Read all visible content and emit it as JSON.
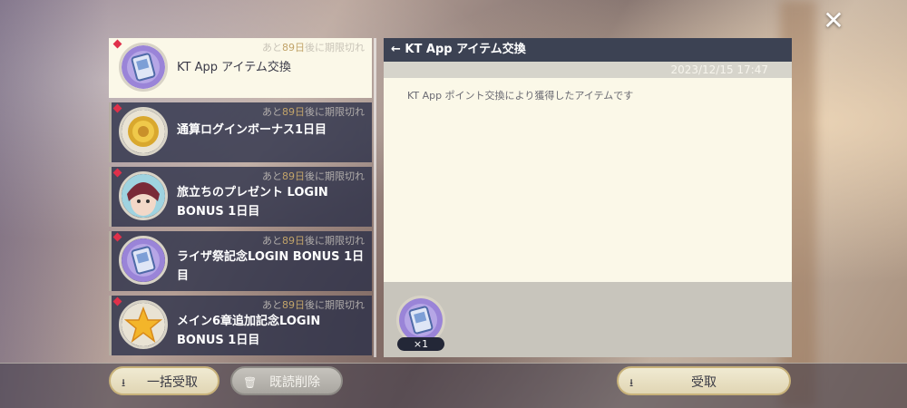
{
  "close_label": "✕",
  "list": {
    "items": [
      {
        "expire_prefix": "あと",
        "expire_days": "89日",
        "expire_suffix": "後に期限切れ",
        "title": "KT App アイテム交換",
        "selected": true
      },
      {
        "expire_prefix": "あと",
        "expire_days": "89日",
        "expire_suffix": "後に期限切れ",
        "title": "通算ログインボーナス1日目",
        "selected": false
      },
      {
        "expire_prefix": "あと",
        "expire_days": "89日",
        "expire_suffix": "後に期限切れ",
        "title": "旅立ちのプレゼント LOGIN BONUS 1日目",
        "selected": false
      },
      {
        "expire_prefix": "あと",
        "expire_days": "89日",
        "expire_suffix": "後に期限切れ",
        "title": "ライザ祭記念LOGIN BONUS 1日目",
        "selected": false
      },
      {
        "expire_prefix": "あと",
        "expire_days": "89日",
        "expire_suffix": "後に期限切れ",
        "title": "メイン6章追加記念LOGIN BONUS 1日目",
        "selected": false
      }
    ]
  },
  "detail": {
    "header": "← KT App アイテム交換",
    "date": "2023/12/15 17:47",
    "body": "KT App ポイント交換により獲得したアイテムです",
    "reward_count": "×1"
  },
  "buttons": {
    "receive_all": "一括受取",
    "delete_read": "既読削除",
    "receive": "受取"
  },
  "colors": {
    "accent_gold": "#c2a46a",
    "header_bg": "#3c4253",
    "selected_bg": "#fbf8e8",
    "unread_dot": "#e0304a"
  }
}
